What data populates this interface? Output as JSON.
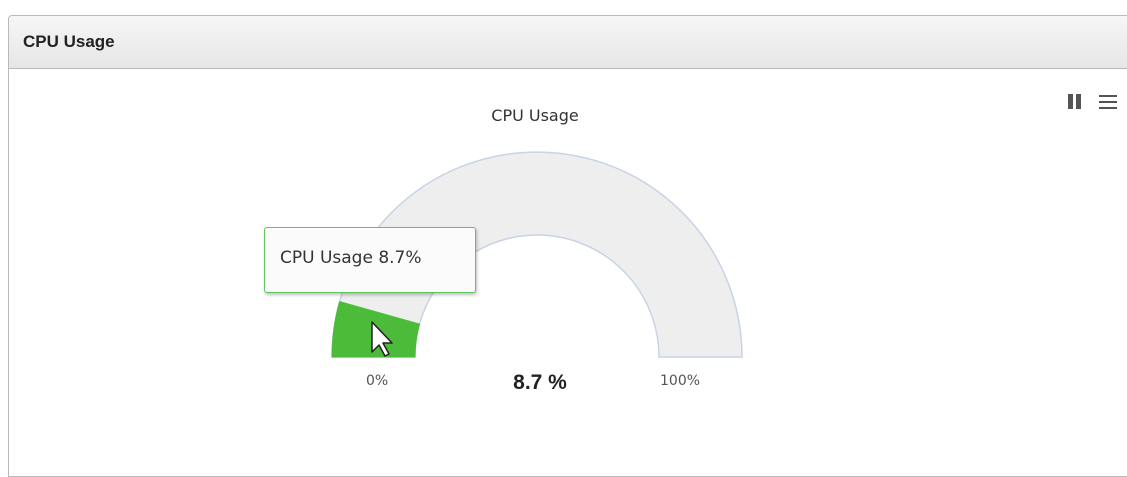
{
  "panel": {
    "title": "CPU Usage"
  },
  "chart_data": {
    "type": "solidgauge",
    "title": "CPU Usage",
    "series": [
      {
        "name": "CPU Usage",
        "values": [
          8.7
        ]
      }
    ],
    "min": 0,
    "max": 100,
    "min_label": "0%",
    "max_label": "100%",
    "value_label": "8.7 %",
    "tooltip": "CPU Usage 8.7%"
  },
  "colors": {
    "fill": "#4dbb3a",
    "track": "#eeeeee",
    "track_border": "#c9d3e6"
  },
  "icons": [
    "pause-icon",
    "hamburger-menu-icon",
    "mouse-pointer-icon"
  ]
}
